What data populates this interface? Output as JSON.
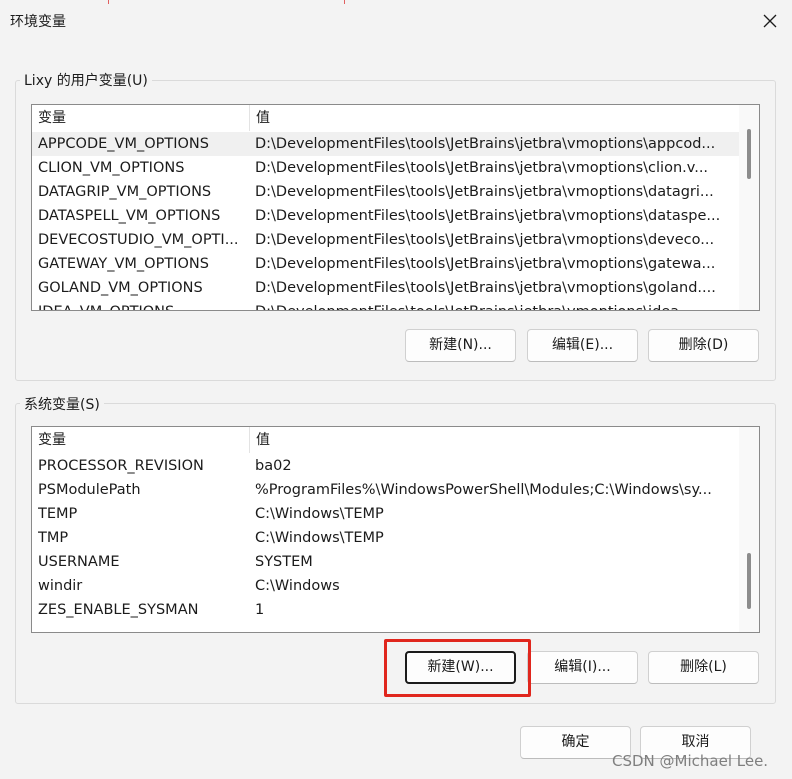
{
  "window": {
    "title": "环境变量"
  },
  "user_vars": {
    "label": "Lixy 的用户变量(U)",
    "columns": {
      "name": "变量",
      "value": "值"
    },
    "rows": [
      {
        "name": "APPCODE_VM_OPTIONS",
        "value": "D:\\DevelopmentFiles\\tools\\JetBrains\\jetbra\\vmoptions\\appcod..."
      },
      {
        "name": "CLION_VM_OPTIONS",
        "value": "D:\\DevelopmentFiles\\tools\\JetBrains\\jetbra\\vmoptions\\clion.v..."
      },
      {
        "name": "DATAGRIP_VM_OPTIONS",
        "value": "D:\\DevelopmentFiles\\tools\\JetBrains\\jetbra\\vmoptions\\datagri..."
      },
      {
        "name": "DATASPELL_VM_OPTIONS",
        "value": "D:\\DevelopmentFiles\\tools\\JetBrains\\jetbra\\vmoptions\\dataspe..."
      },
      {
        "name": "DEVECOSTUDIO_VM_OPTI...",
        "value": "D:\\DevelopmentFiles\\tools\\JetBrains\\jetbra\\vmoptions\\deveco..."
      },
      {
        "name": "GATEWAY_VM_OPTIONS",
        "value": "D:\\DevelopmentFiles\\tools\\JetBrains\\jetbra\\vmoptions\\gatewa..."
      },
      {
        "name": "GOLAND_VM_OPTIONS",
        "value": "D:\\DevelopmentFiles\\tools\\JetBrains\\jetbra\\vmoptions\\goland...."
      },
      {
        "name": "IDEA_VM_OPTIONS",
        "value": "D:\\DevelopmentFiles\\tools\\JetBrains\\jetbra\\vmoptions\\idea..."
      }
    ],
    "buttons": {
      "new": "新建(N)...",
      "edit": "编辑(E)...",
      "delete": "删除(D)"
    }
  },
  "system_vars": {
    "label": "系统变量(S)",
    "columns": {
      "name": "变量",
      "value": "值"
    },
    "rows": [
      {
        "name": "PROCESSOR_REVISION",
        "value": "ba02"
      },
      {
        "name": "PSModulePath",
        "value": "%ProgramFiles%\\WindowsPowerShell\\Modules;C:\\Windows\\sy..."
      },
      {
        "name": "TEMP",
        "value": "C:\\Windows\\TEMP"
      },
      {
        "name": "TMP",
        "value": "C:\\Windows\\TEMP"
      },
      {
        "name": "USERNAME",
        "value": "SYSTEM"
      },
      {
        "name": "windir",
        "value": "C:\\Windows"
      },
      {
        "name": "ZES_ENABLE_SYSMAN",
        "value": "1"
      }
    ],
    "buttons": {
      "new": "新建(W)...",
      "edit": "编辑(I)...",
      "delete": "删除(L)"
    }
  },
  "footer": {
    "ok": "确定",
    "cancel": "取消"
  },
  "watermark": "CSDN @Michael Lee.",
  "colors": {
    "highlight": "#e0261d",
    "dialog_bg": "#f3f3f3"
  },
  "icons": {
    "close": "close-icon"
  }
}
